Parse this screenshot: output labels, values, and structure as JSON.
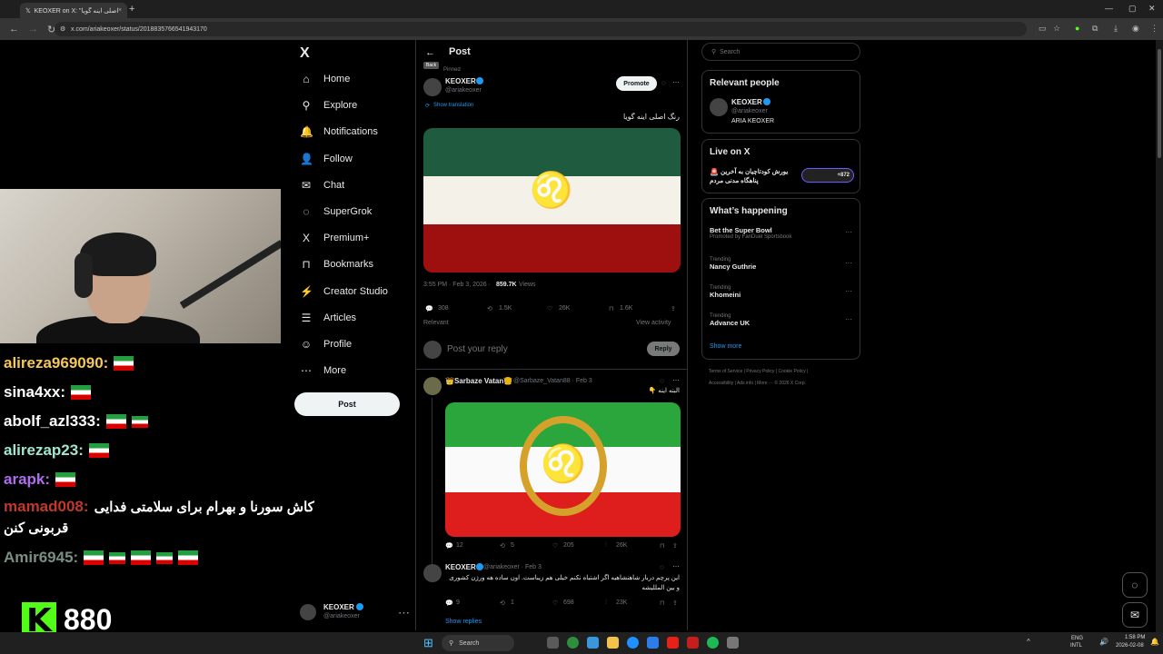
{
  "browser": {
    "tab_title": "KEOXER on X: \"رنگ اصلی اینه گویا\"",
    "tab_close": "×",
    "new_tab": "+",
    "url": "x.com/ariakeoxer/status/2018835766541943170"
  },
  "stream": {
    "chat": [
      {
        "user": "alireza969090:",
        "color": "#f6c85a",
        "flags": 1,
        "text": ""
      },
      {
        "user": "sina4xx:",
        "color": "#ffffff",
        "flags": 1,
        "text": ""
      },
      {
        "user": "abolf_azl333:",
        "color": "#ffffff",
        "flags": 2,
        "text": ""
      },
      {
        "user": "alirezap23:",
        "color": "#9fe8d0",
        "flags": 1,
        "text": ""
      },
      {
        "user": "arapk:",
        "color": "#b06cf0",
        "flags": 1,
        "text": ""
      },
      {
        "user": "mamad008:",
        "color": "#c0392b",
        "flags": 0,
        "text": "کاش سورنا و بهرام برای سلامتی فدایی"
      },
      {
        "user": "Amir6945:",
        "color": "#7a8f82",
        "flags": 5,
        "text": ""
      }
    ],
    "chat_continued": "قربونی کنن",
    "kick_logo_letter": "K",
    "viewer_count": "880"
  },
  "sidebar": {
    "logo": "X",
    "items": [
      {
        "label": "Home",
        "icon": "home-icon",
        "glyph": "⌂"
      },
      {
        "label": "Explore",
        "icon": "search-icon",
        "glyph": "⚲"
      },
      {
        "label": "Notifications",
        "icon": "bell-icon",
        "glyph": "🔔"
      },
      {
        "label": "Follow",
        "icon": "person-plus-icon",
        "glyph": "👤"
      },
      {
        "label": "Chat",
        "icon": "mail-icon",
        "glyph": "✉"
      },
      {
        "label": "SuperGrok",
        "icon": "grok-icon",
        "glyph": "◌"
      },
      {
        "label": "Premium+",
        "icon": "x-premium-icon",
        "glyph": "X"
      },
      {
        "label": "Bookmarks",
        "icon": "bookmark-icon",
        "glyph": "⊓"
      },
      {
        "label": "Creator Studio",
        "icon": "creator-icon",
        "glyph": "⚡"
      },
      {
        "label": "Articles",
        "icon": "articles-icon",
        "glyph": "☰"
      },
      {
        "label": "Profile",
        "icon": "profile-icon",
        "glyph": "☺"
      },
      {
        "label": "More",
        "icon": "more-icon",
        "glyph": "⋯"
      }
    ],
    "post_label": "Post",
    "account": {
      "name": "KEOXER",
      "handle": "@ariakeoxer",
      "more": "⋯"
    }
  },
  "main": {
    "header_title": "Post",
    "back_tooltip": "Back",
    "pinned_label": "Pinned",
    "post": {
      "name": "KEOXER",
      "handle": "@ariakeoxer",
      "promote_label": "Promote",
      "show_translation": "Show translation",
      "text": "رنگ اصلی اینه گویا",
      "time": "3:55 PM · Feb 3, 2026 ·",
      "views_count": "859.7K",
      "views_label": "Views",
      "replies": "308",
      "reposts": "1.5K",
      "likes": "26K",
      "bookmarks": "1.6K"
    },
    "relevant_label": "Relevant",
    "view_activity": "View activity",
    "reply_placeholder": "Post your reply",
    "reply_button": "Reply",
    "reply1": {
      "name": "👑Sarbaze Vatan👑",
      "handle": "@Sarbaze_Vatan88 · Feb 3",
      "text": "البته اینه 👇",
      "replies": "12",
      "reposts": "5",
      "likes": "205",
      "views": "26K"
    },
    "reply2": {
      "name": "KEOXER",
      "handle": "@ariakeoxer · Feb 3",
      "text_line1": "این پرچم دربار شاهنشاهیه اگر اشتباه نکنم خیلی هم زیباست. اون ساده هه ورژن کشوری",
      "text_line2": "و بین المللیشه",
      "replies": "9",
      "reposts": "1",
      "likes": "698",
      "views": "23K"
    },
    "show_replies": "Show replies"
  },
  "right": {
    "search_placeholder": "Search",
    "relevant_people_title": "Relevant people",
    "person": {
      "name": "KEOXER",
      "handle": "@ariakeoxer",
      "bio": "ARIA KEOXER"
    },
    "live_title": "Live on X",
    "live_text_line1": "یورش کودتاچیان به آخرین",
    "live_text_line2": "پناهگاه مدنی مردم",
    "live_count": "+872",
    "happening_title": "What’s happening",
    "trends": [
      {
        "context": "",
        "name": "Bet the Super Bowl",
        "sub": "Promoted by FanDuel Sportsbook"
      },
      {
        "context": "Trending",
        "name": "Nancy Guthrie",
        "sub": ""
      },
      {
        "context": "Trending",
        "name": "Khomeini",
        "sub": ""
      },
      {
        "context": "Trending",
        "name": "Advance UK",
        "sub": ""
      }
    ],
    "show_more": "Show more",
    "footer_line1": "Terms of Service  |  Privacy Policy  |  Cookie Policy  |",
    "footer_line2": "Accessibility  |  Ads info  |  More ···  © 2026 X Corp."
  },
  "taskbar": {
    "search_label": "Search",
    "lang1": "ENG",
    "lang2": "INTL",
    "time": "1:58 PM",
    "date": "2026-02-08"
  },
  "colors": {
    "accent": "#1d9bf0",
    "flag_green": "#239f40",
    "flag_red": "#da0000",
    "kick_green": "#53fc18"
  }
}
